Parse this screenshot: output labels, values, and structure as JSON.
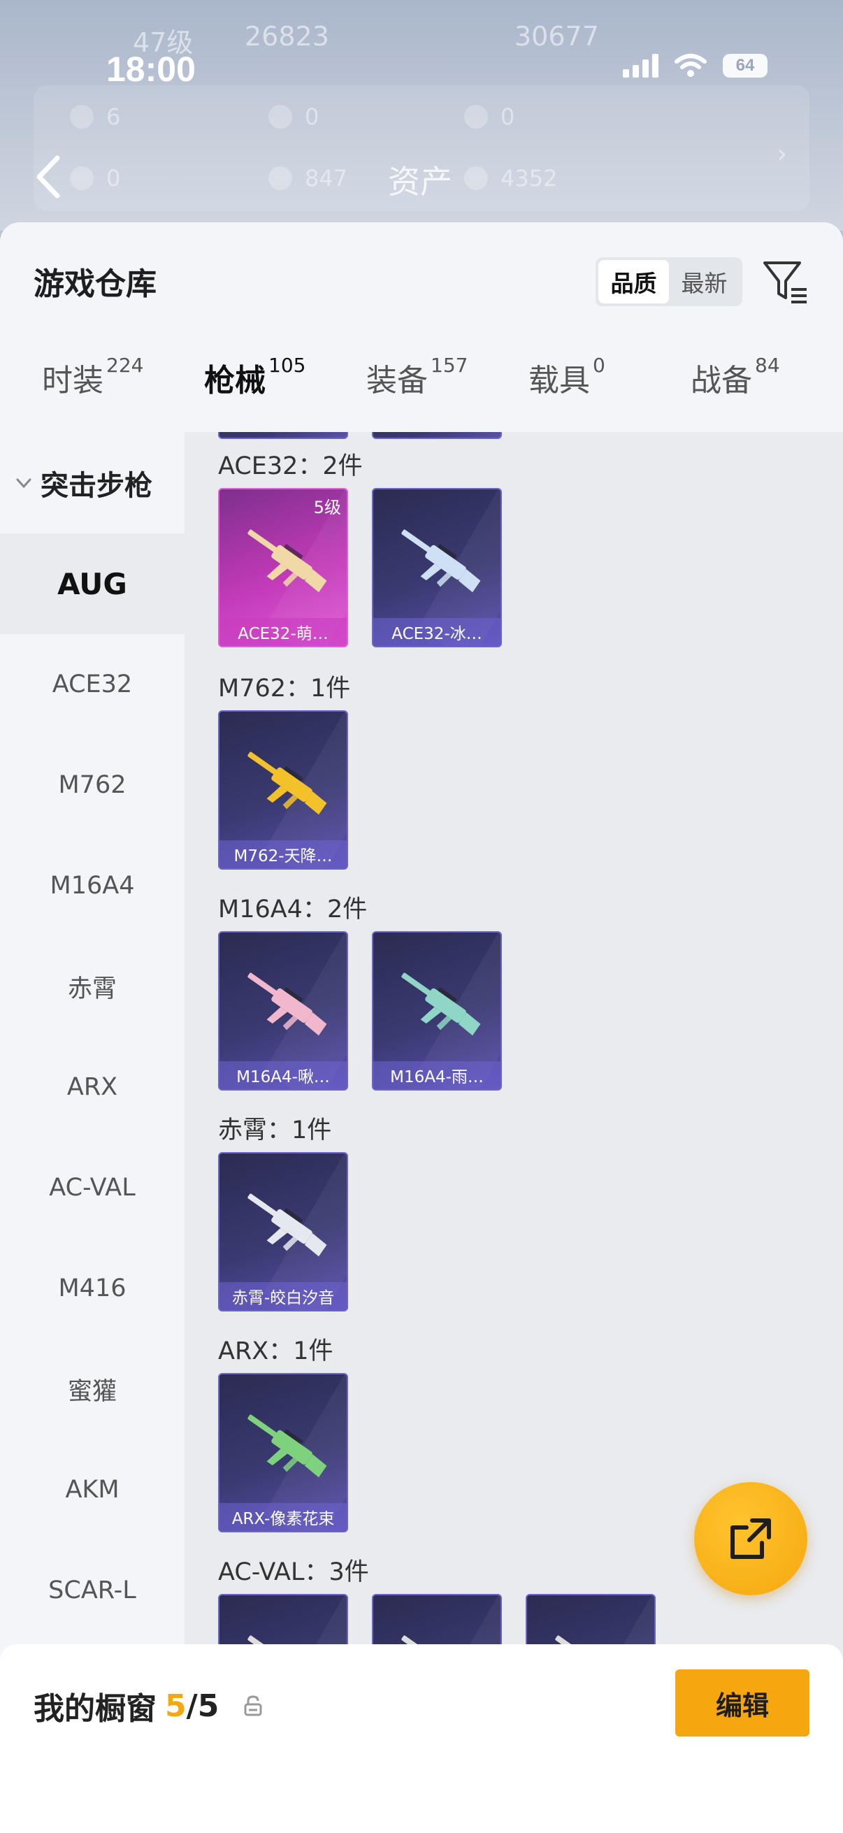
{
  "status_bar": {
    "time": "18:00",
    "battery": "64"
  },
  "backdrop": {
    "level": "47级",
    "coins": "26823",
    "score": "30677",
    "page_title": "资产",
    "stats": [
      "6",
      "0",
      "0",
      "0",
      "847",
      "4352"
    ]
  },
  "header": {
    "title": "游戏仓库",
    "sort_options": [
      "品质",
      "最新"
    ],
    "sort_active": "品质"
  },
  "tabs": [
    {
      "label": "时装",
      "count": "224"
    },
    {
      "label": "枪械",
      "count": "105",
      "active": true
    },
    {
      "label": "装备",
      "count": "157"
    },
    {
      "label": "载具",
      "count": "0"
    },
    {
      "label": "战备",
      "count": "84"
    }
  ],
  "sidebar": {
    "group": "突击步枪",
    "items": [
      "AUG",
      "ACE32",
      "M762",
      "M16A4",
      "赤霄",
      "ARX",
      "AC-VAL",
      "M416",
      "蜜獾",
      "AKM",
      "SCAR-L"
    ],
    "active": "AUG"
  },
  "sections": [
    {
      "label": "ACE32：2件",
      "cards": [
        {
          "name": "ACE32-萌…",
          "level": "5级",
          "style": "pink",
          "gun_color": "#f0d9a6"
        },
        {
          "name": "ACE32-冰…",
          "style": "purple",
          "gun_color": "#cfe0f5"
        }
      ]
    },
    {
      "label": "M762：1件",
      "cards": [
        {
          "name": "M762-天降…",
          "style": "purple",
          "gun_color": "#f3c22b"
        }
      ]
    },
    {
      "label": "M16A4：2件",
      "cards": [
        {
          "name": "M16A4-啾…",
          "style": "purple",
          "gun_color": "#f1b8cd"
        },
        {
          "name": "M16A4-雨…",
          "style": "purple",
          "gun_color": "#8fd6c6"
        }
      ]
    },
    {
      "label": "赤霄：1件",
      "cards": [
        {
          "name": "赤霄-皎白汐音",
          "style": "purple",
          "gun_color": "#e6e8f0"
        }
      ]
    },
    {
      "label": "ARX：1件",
      "cards": [
        {
          "name": "ARX-像素花束",
          "style": "purple",
          "gun_color": "#7ed27e"
        }
      ]
    },
    {
      "label": "AC-VAL：3件",
      "cards": [
        {
          "name": "",
          "style": "purple",
          "gun_color": "#ddd"
        },
        {
          "name": "",
          "style": "purple",
          "gun_color": "#ddd"
        },
        {
          "name": "",
          "style": "purple",
          "gun_color": "#ddd"
        }
      ]
    }
  ],
  "showcase": {
    "label": "我的橱窗",
    "current": "5",
    "total": "/5",
    "edit_label": "编辑"
  }
}
